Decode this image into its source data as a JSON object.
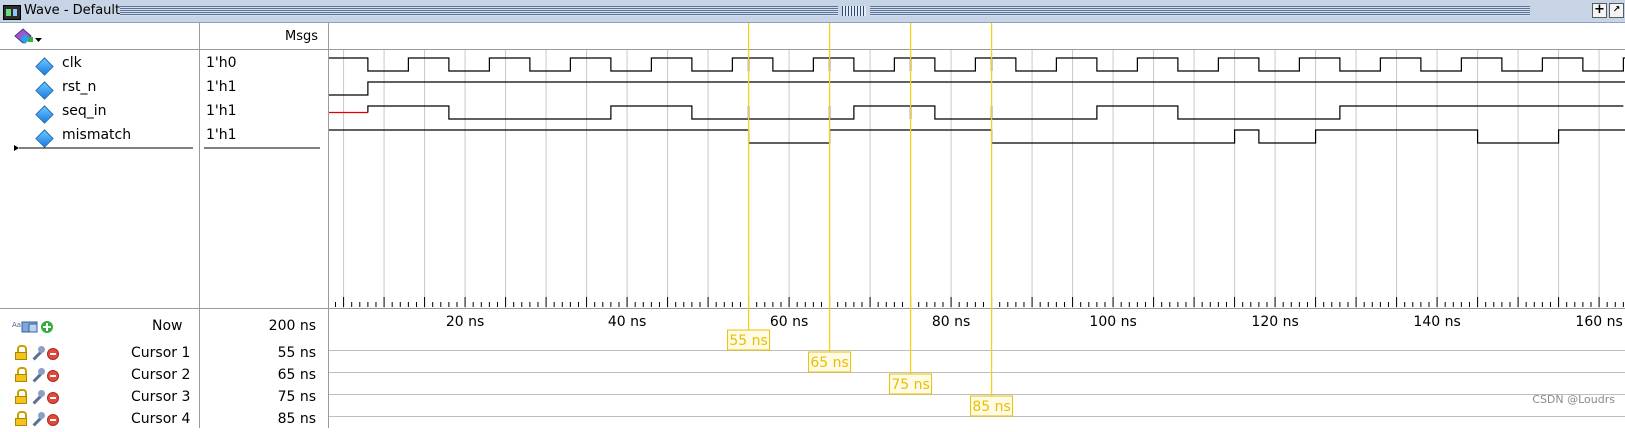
{
  "window": {
    "title": "Wave - Default"
  },
  "header": {
    "msgs_label": "Msgs"
  },
  "signals": [
    {
      "name": "clk",
      "value": "1'h0"
    },
    {
      "name": "rst_n",
      "value": "1'h1"
    },
    {
      "name": "seq_in",
      "value": "1'h1"
    },
    {
      "name": "mismatch",
      "value": "1'h1"
    }
  ],
  "now": {
    "label": "Now",
    "value": "200 ns"
  },
  "cursors": [
    {
      "label": "Cursor 1",
      "value": "55 ns",
      "time": 55
    },
    {
      "label": "Cursor 2",
      "value": "65 ns",
      "time": 65
    },
    {
      "label": "Cursor 3",
      "value": "75 ns",
      "time": 75
    },
    {
      "label": "Cursor 4",
      "value": "85 ns",
      "time": 85
    }
  ],
  "timeline": {
    "start_ns": 3.2,
    "end_ns": 163.2,
    "unit": "ns",
    "labeled_ticks": [
      20,
      40,
      60,
      80,
      100,
      120,
      140,
      160
    ]
  },
  "waves": {
    "clk_period_ns": 10,
    "clk_first_rise_ns": 8,
    "rst_n_release_ns": 8,
    "seq_in_unknown_until_ns": 8,
    "seq_in_transitions": [
      [
        8,
        1
      ],
      [
        18,
        0
      ],
      [
        38,
        1
      ],
      [
        48,
        0
      ],
      [
        58,
        0
      ],
      [
        68,
        1
      ],
      [
        78,
        0
      ],
      [
        98,
        1
      ],
      [
        108,
        0
      ],
      [
        128,
        1
      ],
      [
        163,
        1
      ]
    ],
    "mismatch_transitions": [
      [
        3.2,
        1
      ],
      [
        55,
        0
      ],
      [
        65,
        1
      ],
      [
        85,
        0
      ],
      [
        115,
        1
      ],
      [
        118,
        0
      ],
      [
        125,
        1
      ],
      [
        145,
        0
      ],
      [
        155,
        1
      ]
    ]
  },
  "colors": {
    "cursor": "#f2d21e",
    "cursor_label": "#e8c000",
    "grid": "#c8c8c8",
    "wave": "#000000",
    "wave_highlight": "#1a3fd8",
    "unknown": "#e00000"
  },
  "watermark": "CSDN @Loudrs"
}
